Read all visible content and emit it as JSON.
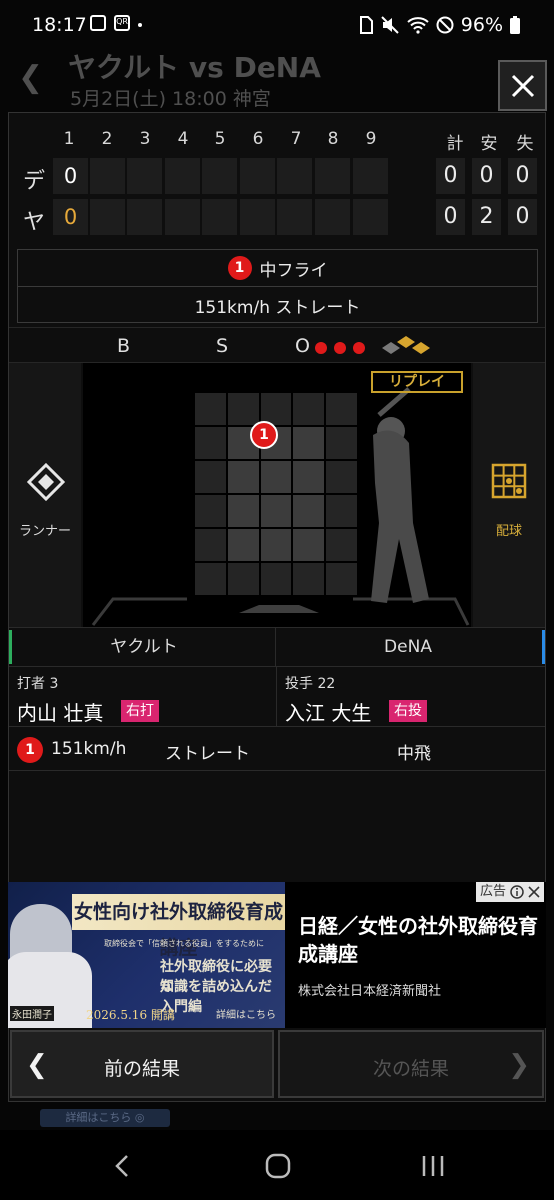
{
  "status_bar": {
    "time": "18:17",
    "battery": "96%",
    "icons_left": [
      "image-icon",
      "qr-icon",
      "more-dot"
    ],
    "icons_right": [
      "sim-icon",
      "mute-icon",
      "wifi-icon",
      "dnd-icon"
    ]
  },
  "background_page": {
    "title": "ヤクルト vs DeNA",
    "subtitle": "5月2日(土) 18:00 神宮",
    "footer_link": "詳細はこちら ◎"
  },
  "scoreboard": {
    "innings": [
      "1",
      "2",
      "3",
      "4",
      "5",
      "6",
      "7",
      "8",
      "9"
    ],
    "totals_headers": [
      "計",
      "安",
      "失"
    ],
    "rows": [
      {
        "team": "デ",
        "scores": [
          "0",
          "",
          "",
          "",
          "",
          "",
          "",
          "",
          ""
        ],
        "totals": [
          "0",
          "0",
          "0"
        ],
        "first_color": "#ffffff"
      },
      {
        "team": "ヤ",
        "scores": [
          "0",
          "",
          "",
          "",
          "",
          "",
          "",
          "",
          ""
        ],
        "totals": [
          "0",
          "2",
          "0"
        ],
        "first_color": "#e6a93a"
      }
    ]
  },
  "play": {
    "number": "1",
    "result": "中フライ",
    "detail": "151km/h ストレート"
  },
  "count": {
    "b_label": "B",
    "s_label": "S",
    "o_label": "O",
    "balls": 0,
    "strikes": 0,
    "outs": 3,
    "out_color": "#e01a1a"
  },
  "field": {
    "replay_label": "リプレイ",
    "runner_label": "ランナー",
    "pitch_chart_label": "配球",
    "pitch_marker": "1",
    "pitch_marker_location": {
      "col": 2,
      "row": 1
    }
  },
  "teams": {
    "left": "ヤクルト",
    "right": "DeNA",
    "left_color": "#2dae5e",
    "right_color": "#2a8be6"
  },
  "batter": {
    "role": "打者 3",
    "name": "内山 壮真",
    "hand": "右打"
  },
  "pitcher": {
    "role": "投手 22",
    "name": "入江 大生",
    "hand": "右投"
  },
  "pitch_log": [
    {
      "num": "1",
      "speed": "151km/h",
      "type": "ストレート",
      "result": "中飛"
    }
  ],
  "ad": {
    "tag": "広告",
    "banner_heading": "女性向け社外取締役育成講座",
    "banner_line1": "取締役会で「信頼される役員」をするために",
    "banner_line2": "社外取締役に必要な",
    "banner_line3": "知識を詰め込んだ入門編",
    "banner_date": "2026.5.16 開講",
    "banner_detail": "詳細はこちら",
    "banner_person": "永田潤子",
    "title": "日経／女性の社外取締役育成講座",
    "company": "株式会社日本経済新聞社"
  },
  "nav": {
    "prev": "前の結果",
    "next": "次の結果"
  },
  "accent_colors": {
    "out": "#e01a1a",
    "hand_badge": "#d9256f",
    "gold": "#c9a12c"
  }
}
